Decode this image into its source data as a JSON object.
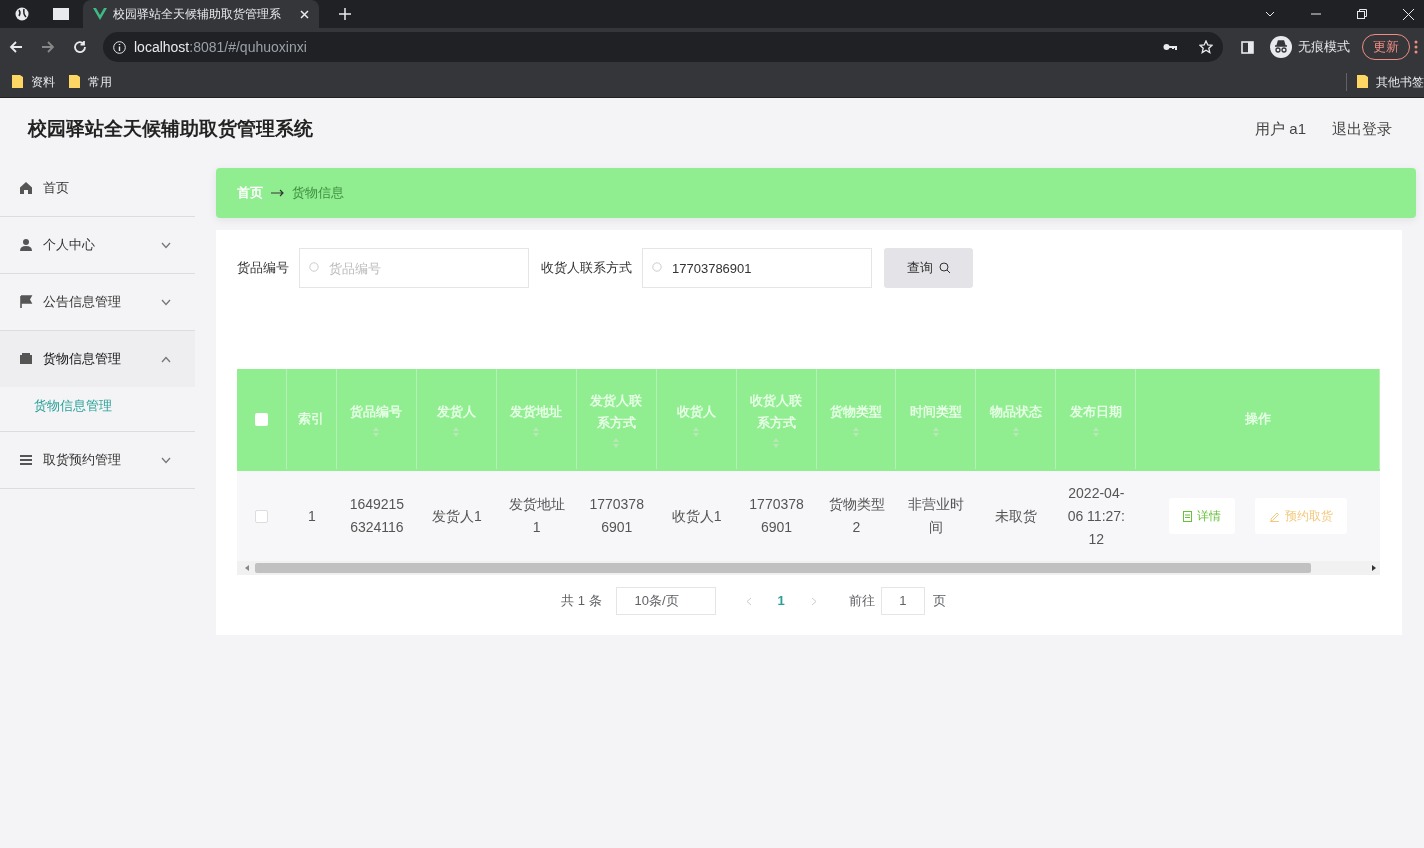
{
  "browser": {
    "tab_title": "校园驿站全天候辅助取货管理系",
    "url_host": "localhost",
    "url_path": ":8081/#/quhuoxinxi",
    "bookmarks": [
      "资料",
      "常用"
    ],
    "other_bookmarks": "其他书签",
    "profile": "无痕模式",
    "update": "更新"
  },
  "header": {
    "title": "校园驿站全天候辅助取货管理系统",
    "user": "用户 a1",
    "logout": "退出登录"
  },
  "sidebar": {
    "items": [
      {
        "label": "首页"
      },
      {
        "label": "个人中心",
        "expanded": false
      },
      {
        "label": "公告信息管理",
        "expanded": false
      },
      {
        "label": "货物信息管理",
        "expanded": true,
        "children": [
          {
            "label": "货物信息管理",
            "selected": true
          }
        ]
      },
      {
        "label": "取货预约管理",
        "expanded": false
      }
    ]
  },
  "breadcrumb": [
    "首页",
    "货物信息"
  ],
  "search": {
    "fields": [
      {
        "label": "货品编号",
        "placeholder": "货品编号"
      },
      {
        "label": "收货人联系方式",
        "value": "17703786901"
      }
    ],
    "button": "查询"
  },
  "table": {
    "select_all_checked": false,
    "columns": [
      "索引",
      "货品编号",
      "发货人",
      "发货地址",
      "发货人联系方式",
      "收货人",
      "收货人联系方式",
      "货物类型",
      "时间类型",
      "物品状态",
      "发布日期",
      "操作"
    ],
    "rows": [
      {
        "checked": false,
        "cells": [
          "1",
          "16492156324116",
          "发货人1",
          "发货地址1",
          "17703786901",
          "收货人1",
          "17703786901",
          "货物类型2",
          "非营业时间",
          "未取货",
          "2022-04-06 11:27:12"
        ],
        "actions": [
          {
            "kind": "detail",
            "label": "详情"
          },
          {
            "kind": "reserve",
            "label": "预约取货"
          }
        ]
      }
    ]
  },
  "pagination": {
    "total": "共 1 条",
    "page_size": "10条/页",
    "pages": [
      {
        "label": "1",
        "selected": true
      }
    ],
    "goto_label": "前往",
    "goto_value": "1",
    "goto_suffix": "页"
  }
}
